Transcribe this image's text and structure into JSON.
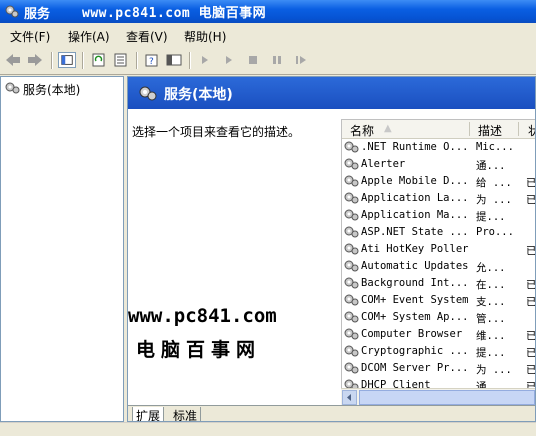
{
  "window": {
    "title": "服务",
    "watermark": "www.pc841.com 电脑百事网"
  },
  "menu": [
    "文件(F)",
    "操作(A)",
    "查看(V)",
    "帮助(H)"
  ],
  "tree": {
    "root_label": "服务(本地)"
  },
  "main": {
    "header_title": "服务(本地)",
    "description_prompt": "选择一个项目来查看它的描述。",
    "watermark_site": "www.pc841.com",
    "watermark_cn": "电脑百事网"
  },
  "list": {
    "columns": [
      "名称",
      "描述",
      "状"
    ],
    "rows": [
      {
        "name": ".NET Runtime O...",
        "desc": "Mic...",
        "status": ""
      },
      {
        "name": "Alerter",
        "desc": "通...",
        "status": ""
      },
      {
        "name": "Apple Mobile D...",
        "desc": "给 ...",
        "status": "已"
      },
      {
        "name": "Application La...",
        "desc": "为 ...",
        "status": "已"
      },
      {
        "name": "Application Ma...",
        "desc": "提...",
        "status": ""
      },
      {
        "name": "ASP.NET State ...",
        "desc": "Pro...",
        "status": ""
      },
      {
        "name": "Ati HotKey Poller",
        "desc": "",
        "status": "已"
      },
      {
        "name": "Automatic Updates",
        "desc": "允...",
        "status": ""
      },
      {
        "name": "Background Int...",
        "desc": "在...",
        "status": "已"
      },
      {
        "name": "COM+ Event System",
        "desc": "支...",
        "status": "已"
      },
      {
        "name": "COM+ System Ap...",
        "desc": "管...",
        "status": ""
      },
      {
        "name": "Computer Browser",
        "desc": "维...",
        "status": "已"
      },
      {
        "name": "Cryptographic ...",
        "desc": "提...",
        "status": "已"
      },
      {
        "name": "DCOM Server Pr...",
        "desc": "为 ...",
        "status": "已"
      },
      {
        "name": "DHCP Client",
        "desc": "通 ...",
        "status": "已"
      }
    ]
  },
  "tabs": [
    "扩展",
    "标准"
  ],
  "colors": {
    "titlebar": "#0a5fe2",
    "header_band": "#2c6ad9",
    "chrome": "#ece9d8"
  }
}
